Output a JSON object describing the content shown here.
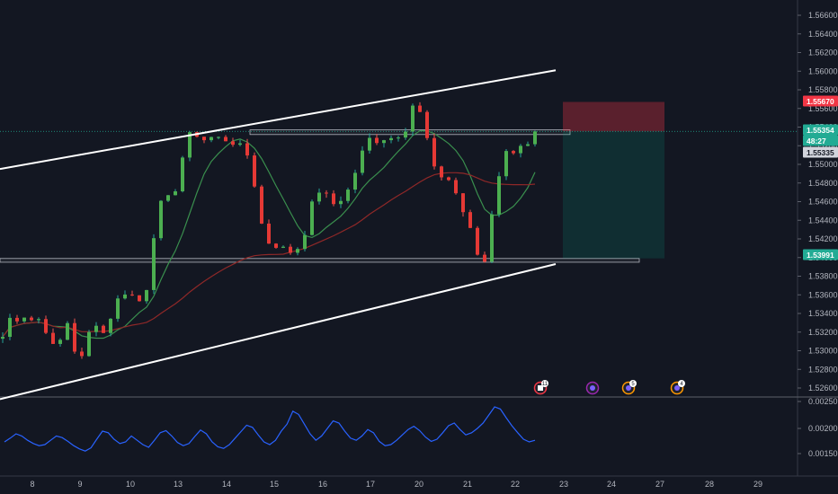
{
  "chart_data": [
    {
      "type": "candlestick",
      "title": "",
      "x_tick_labels": [
        "8",
        "9",
        "10",
        "13",
        "14",
        "15",
        "16",
        "17",
        "20",
        "21",
        "22",
        "23",
        "24",
        "27",
        "28",
        "29"
      ],
      "y_tick_labels": [
        "1.52600",
        "1.52800",
        "1.53000",
        "1.53200",
        "1.53400",
        "1.53600",
        "1.53800",
        "1.54000",
        "1.54200",
        "1.54400",
        "1.54600",
        "1.54800",
        "1.55000",
        "1.55200",
        "1.55400",
        "1.55600",
        "1.55800",
        "1.56000",
        "1.56200",
        "1.56400",
        "1.56600"
      ],
      "ylim": [
        1.5245,
        1.5675
      ],
      "grid": false,
      "close_path": [
        1.5315,
        1.5335,
        1.5335,
        1.5338,
        1.5333,
        1.5334,
        1.5322,
        1.5302,
        1.5312,
        1.5333,
        1.5296,
        1.5291,
        1.5324,
        1.5332,
        1.5316,
        1.5342,
        1.5358,
        1.5365,
        1.5357,
        1.5352,
        1.5374,
        1.5445,
        1.5462,
        1.5463,
        1.548,
        1.5522,
        1.5535,
        1.5531,
        1.5524,
        1.5532,
        1.5525,
        1.5528,
        1.5521,
        1.5516,
        1.5505,
        1.5455,
        1.5418,
        1.5415,
        1.5412,
        1.5406,
        1.5407,
        1.5415,
        1.5445,
        1.5472,
        1.5472,
        1.5455,
        1.5462,
        1.5465,
        1.5485,
        1.5505,
        1.5528,
        1.5525,
        1.5529,
        1.5527,
        1.5533,
        1.5531,
        1.5565,
        1.556,
        1.5535,
        1.5495,
        1.5488,
        1.5486,
        1.5472,
        1.5452,
        1.5432,
        1.5405,
        1.5391,
        1.5445,
        1.5488,
        1.5512,
        1.5515,
        1.5522,
        1.5519,
        1.5535
      ],
      "series": [
        {
          "name": "",
          "type": "moving_average",
          "color": "#3a8f4e"
        },
        {
          "name": "",
          "type": "moving_average",
          "color": "#8f2828"
        }
      ],
      "annotations": {
        "resistance_zone": [
          1.5532,
          1.5537
        ],
        "support_zone": [
          1.5395,
          1.5399
        ],
        "channel_upper": [
          [
            0,
            1.5495
          ],
          [
            124,
            1.5601
          ]
        ],
        "channel_lower": [
          [
            0,
            1.5248
          ],
          [
            124,
            1.5393
          ]
        ],
        "position": {
          "type": "short",
          "stop": 1.5567,
          "entry": 1.55354,
          "target": 1.53991
        }
      },
      "price_tags": [
        {
          "label": "1.55670",
          "color": "#f23645"
        },
        {
          "label": "1.55354",
          "color": "#22ab94"
        },
        {
          "label": "48:27",
          "color": "#22ab94"
        },
        {
          "label": "1.55335",
          "color": "#d1d4dc"
        },
        {
          "label": "1.53991",
          "color": "#22ab94"
        }
      ],
      "event_badges": [
        {
          "icon": "calendar-icon",
          "count": "11",
          "color": "#f23645"
        },
        {
          "icon": "globe-icon",
          "count": "",
          "color": "#9c27b0"
        },
        {
          "icon": "globe-icon",
          "count": "5",
          "color": "#ff9800"
        },
        {
          "icon": "globe-icon",
          "count": "4",
          "color": "#ff9800"
        }
      ]
    },
    {
      "type": "line",
      "title": "",
      "y_tick_labels": [
        "0.00250",
        "0.00200",
        "0.00150"
      ],
      "ylim": [
        0.00125,
        0.0026
      ],
      "color": "#2962ff",
      "values": [
        0.00175,
        0.00182,
        0.0019,
        0.00186,
        0.00178,
        0.00172,
        0.00168,
        0.0017,
        0.00178,
        0.00186,
        0.00183,
        0.00176,
        0.00168,
        0.00162,
        0.00158,
        0.00164,
        0.0018,
        0.00195,
        0.00192,
        0.0018,
        0.00172,
        0.00175,
        0.00186,
        0.00178,
        0.0017,
        0.00165,
        0.00178,
        0.00192,
        0.00196,
        0.00186,
        0.00174,
        0.00168,
        0.00172,
        0.00185,
        0.00197,
        0.0019,
        0.00175,
        0.00166,
        0.00163,
        0.0017,
        0.00182,
        0.00194,
        0.00206,
        0.00202,
        0.00188,
        0.00175,
        0.0017,
        0.00178,
        0.00195,
        0.00208,
        0.00232,
        0.00226,
        0.00208,
        0.0019,
        0.00178,
        0.00186,
        0.002,
        0.00214,
        0.0021,
        0.00195,
        0.00182,
        0.00178,
        0.00186,
        0.00198,
        0.00192,
        0.00176,
        0.00168,
        0.0017,
        0.00178,
        0.00188,
        0.00198,
        0.00204,
        0.00196,
        0.00184,
        0.00176,
        0.0018,
        0.00192,
        0.00205,
        0.0021,
        0.00198,
        0.00188,
        0.00192,
        0.002,
        0.0021,
        0.00225,
        0.0024,
        0.00236,
        0.0022,
        0.00205,
        0.00192,
        0.0018,
        0.00175,
        0.00178
      ]
    }
  ]
}
